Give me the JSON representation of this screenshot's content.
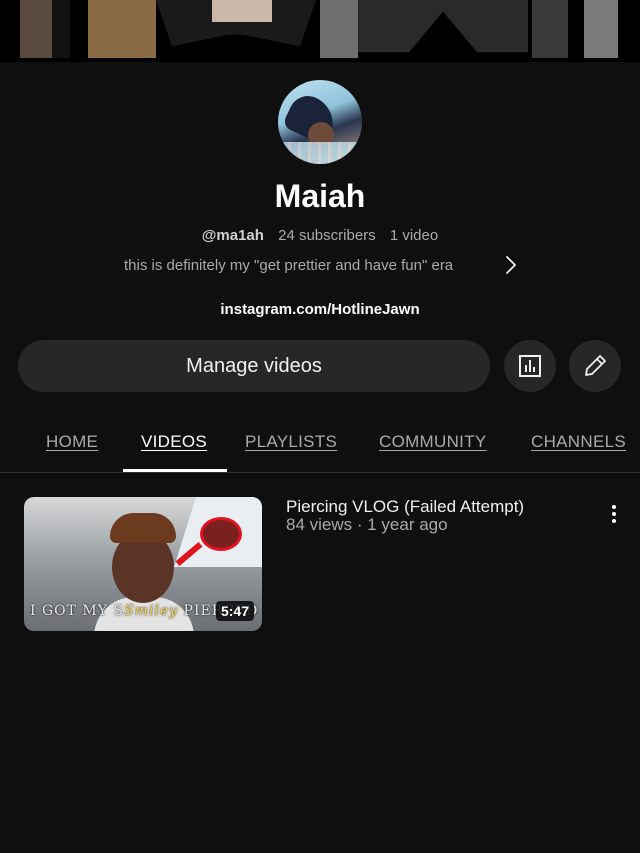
{
  "channel": {
    "name": "Maiah",
    "handle": "@ma1ah",
    "subscribers": "24 subscribers",
    "video_count": "1 video",
    "description": "this is definitely my \"get prettier and have fun\" era",
    "link": "instagram.com/HotlineJawn"
  },
  "actions": {
    "manage_label": "Manage videos",
    "analytics_icon": "analytics-icon",
    "edit_icon": "edit-pencil-icon"
  },
  "tabs": [
    {
      "label": "HOME",
      "active": false
    },
    {
      "label": "VIDEOS",
      "active": true
    },
    {
      "label": "PLAYLISTS",
      "active": false
    },
    {
      "label": "COMMUNITY",
      "active": false
    },
    {
      "label": "CHANNELS",
      "active": false
    }
  ],
  "videos": [
    {
      "title": "Piercing VLOG (Failed Attempt)",
      "meta": "84 views · 1 year ago",
      "duration": "5:47",
      "thumbnail_caption_left": "I GOT MY S",
      "thumbnail_caption_script": "Smiley",
      "thumbnail_caption_right": "PIERCED"
    }
  ],
  "colors": {
    "background": "#0f0f0f",
    "surface": "#272727",
    "text_primary": "#f1f1f1",
    "text_secondary": "#aaaaaa"
  }
}
